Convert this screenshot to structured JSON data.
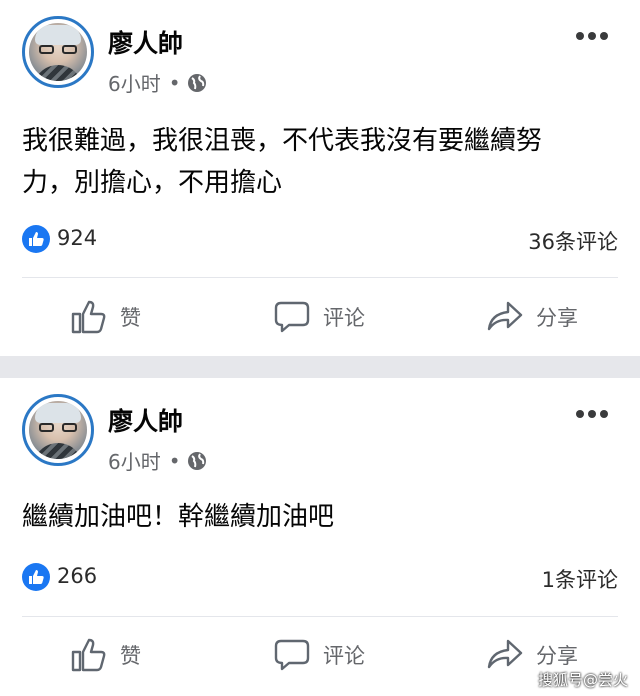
{
  "posts": [
    {
      "author": "廖人帥",
      "time": "6小时",
      "dot": "•",
      "privacy_icon": "globe-icon",
      "content_lines": [
        "我很難過，我很沮喪，不代表我沒有要繼續努",
        "力，別擔心，不用擔心"
      ],
      "likes": "924",
      "comments": "36条评论"
    },
    {
      "author": "廖人帥",
      "time": "6小时",
      "dot": "•",
      "privacy_icon": "globe-icon",
      "content_lines": [
        "繼續加油吧！幹繼續加油吧"
      ],
      "likes": "266",
      "comments": "1条评论"
    }
  ],
  "actions": {
    "like": "赞",
    "comment": "评论",
    "share": "分享"
  },
  "watermark": "搜狐号@尝火",
  "colors": {
    "like_blue": "#1a77f2",
    "secondary_text": "#65676b",
    "separator": "#e6e7eb"
  }
}
